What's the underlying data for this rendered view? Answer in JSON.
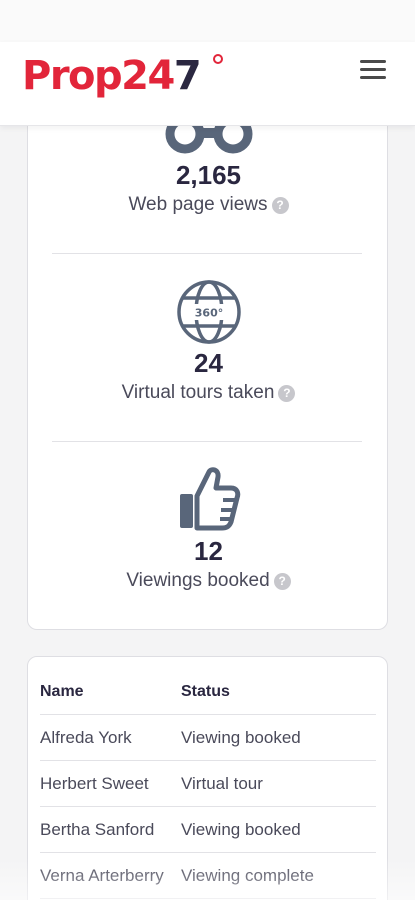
{
  "header": {
    "logo_part1": "Prop24",
    "logo_part2": "7",
    "menu_icon": "hamburger-menu-icon"
  },
  "stats": [
    {
      "icon": "binoculars-icon",
      "value": "2,165",
      "label": "Web page views",
      "help_icon": "question-circle-icon"
    },
    {
      "icon": "globe-360-icon",
      "value": "24",
      "label": "Virtual tours taken",
      "help_icon": "question-circle-icon",
      "icon_text": "360°"
    },
    {
      "icon": "thumbs-up-icon",
      "value": "12",
      "label": "Viewings booked",
      "help_icon": "question-circle-icon"
    }
  ],
  "table": {
    "columns": [
      "Name",
      "Status"
    ],
    "rows": [
      [
        "Alfreda York",
        "Viewing booked"
      ],
      [
        "Herbert Sweet",
        "Virtual tour"
      ],
      [
        "Bertha Sanford",
        "Viewing booked"
      ],
      [
        "Verna Arterberry",
        "Viewing complete"
      ]
    ]
  },
  "colors": {
    "brand_red": "#e2253a",
    "brand_navy": "#2a2740",
    "icon_slate": "#59667a"
  }
}
